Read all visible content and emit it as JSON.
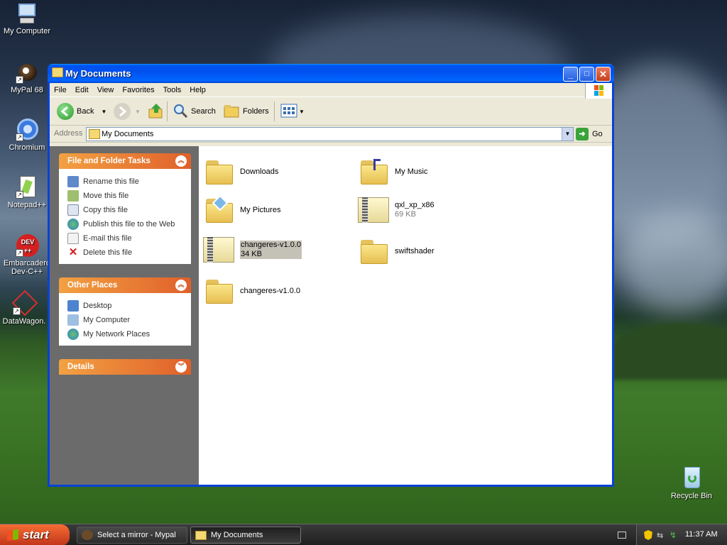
{
  "desktop": {
    "icons": [
      {
        "label": "My Computer",
        "icon": "computer-icon"
      },
      {
        "label": "MyPal 68",
        "icon": "mypal-icon"
      },
      {
        "label": "Chromium",
        "icon": "chromium-icon"
      },
      {
        "label": "Notepad++",
        "icon": "notepadpp-icon"
      },
      {
        "label": "Embarcadero Dev-C++",
        "icon": "devcpp-icon"
      },
      {
        "label": "DataWagon.",
        "icon": "datawagon-icon"
      },
      {
        "label": "Recycle Bin",
        "icon": "recycle-bin-icon"
      }
    ]
  },
  "window": {
    "title": "My Documents",
    "controls": {
      "minimize": "_",
      "maximize": "□",
      "close": "✕"
    }
  },
  "menu": [
    "File",
    "Edit",
    "View",
    "Favorites",
    "Tools",
    "Help"
  ],
  "toolbar": {
    "back_label": "Back",
    "search_label": "Search",
    "folders_label": "Folders"
  },
  "address": {
    "label": "Address",
    "value": "My Documents",
    "go_label": "Go"
  },
  "tasks": {
    "file_folder": {
      "title": "File and Folder Tasks",
      "items": [
        {
          "label": "Rename this file",
          "icon": "rename-icon"
        },
        {
          "label": "Move this file",
          "icon": "move-icon"
        },
        {
          "label": "Copy this file",
          "icon": "copy-icon"
        },
        {
          "label": "Publish this file to the Web",
          "icon": "publish-web-icon"
        },
        {
          "label": "E-mail this file",
          "icon": "email-icon"
        },
        {
          "label": "Delete this file",
          "icon": "delete-icon"
        }
      ]
    },
    "other_places": {
      "title": "Other Places",
      "items": [
        {
          "label": "Desktop",
          "icon": "desktop-icon"
        },
        {
          "label": "My Computer",
          "icon": "my-computer-icon"
        },
        {
          "label": "My Network Places",
          "icon": "network-places-icon"
        }
      ]
    },
    "details": {
      "title": "Details"
    }
  },
  "files": [
    {
      "name": "Downloads",
      "kind": "folder"
    },
    {
      "name": "My Music",
      "kind": "folder"
    },
    {
      "name": "My Pictures",
      "kind": "folder"
    },
    {
      "name": "qxl_xp_x86",
      "size": "69 KB",
      "kind": "zip"
    },
    {
      "name": "changeres-v1.0.0",
      "size": "34 KB",
      "kind": "zip",
      "selected": true
    },
    {
      "name": "swiftshader",
      "kind": "folder"
    },
    {
      "name": "changeres-v1.0.0",
      "kind": "folder"
    }
  ],
  "taskbar": {
    "start_label": "start",
    "tasks": [
      {
        "label": "Select a mirror - Mypal",
        "active": false
      },
      {
        "label": "My Documents",
        "active": true
      }
    ],
    "clock": "11:37 AM"
  }
}
